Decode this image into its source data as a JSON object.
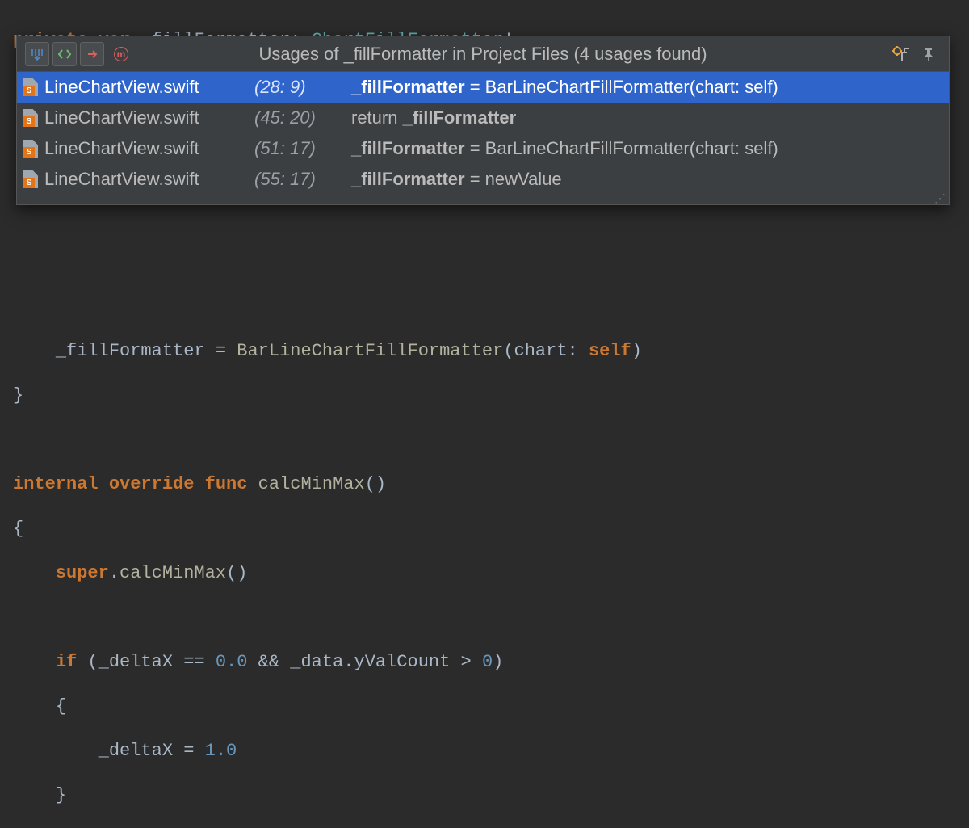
{
  "code": {
    "l1_private": "private",
    "l1_var": "var",
    "l1_ident": "_fillFormatter",
    "l1_type": "ChartFillFormatter",
    "l1_bang": "!",
    "l2_ident": "_fillFormatter",
    "l2_eq": " = ",
    "l2_call_fn": "BarLineChartFillFormatter",
    "l2_call_open": "(",
    "l2_arg_label": "chart",
    "l2_arg_colon": ": ",
    "l2_arg_self": "self",
    "l2_call_close": ")",
    "l3_brace": "}",
    "l5_internal": "internal",
    "l5_override": "override",
    "l5_func": "func",
    "l5_name": "calcMinMax",
    "l5_parens": "()",
    "l6_brace": "{",
    "l7_super": "super",
    "l7_dot": ".",
    "l7_call": "calcMinMax",
    "l7_parens": "()",
    "l9_if": "if",
    "l9_open": " (",
    "l9_a": "_deltaX",
    "l9_eqeq": " == ",
    "l9_zero": "0.0",
    "l9_and": " && ",
    "l9_b": "_data",
    "l9_dot": ".",
    "l9_c": "yValCount",
    "l9_gt": " > ",
    "l9_zero2": "0",
    "l9_close": ")",
    "l10_brace": "{",
    "l11_a": "_deltaX",
    "l11_eq": " = ",
    "l11_one": "1.0",
    "l12_brace": "}"
  },
  "popup": {
    "title": "Usages of _fillFormatter in Project Files (4 usages found)",
    "m_marker": "m",
    "rows": [
      {
        "file": "LineChartView.swift",
        "pos": "(28: 9)",
        "pre": "",
        "hl": "_fillFormatter",
        "post": " = BarLineChartFillFormatter(chart: self)",
        "selected": true
      },
      {
        "file": "LineChartView.swift",
        "pos": "(45: 20)",
        "pre": "return ",
        "hl": "_fillFormatter",
        "post": "",
        "selected": false
      },
      {
        "file": "LineChartView.swift",
        "pos": "(51: 17)",
        "pre": "",
        "hl": "_fillFormatter",
        "post": " = BarLineChartFillFormatter(chart: self)",
        "selected": false
      },
      {
        "file": "LineChartView.swift",
        "pos": "(55: 17)",
        "pre": "",
        "hl": "_fillFormatter",
        "post": " = newValue",
        "selected": false
      }
    ]
  }
}
